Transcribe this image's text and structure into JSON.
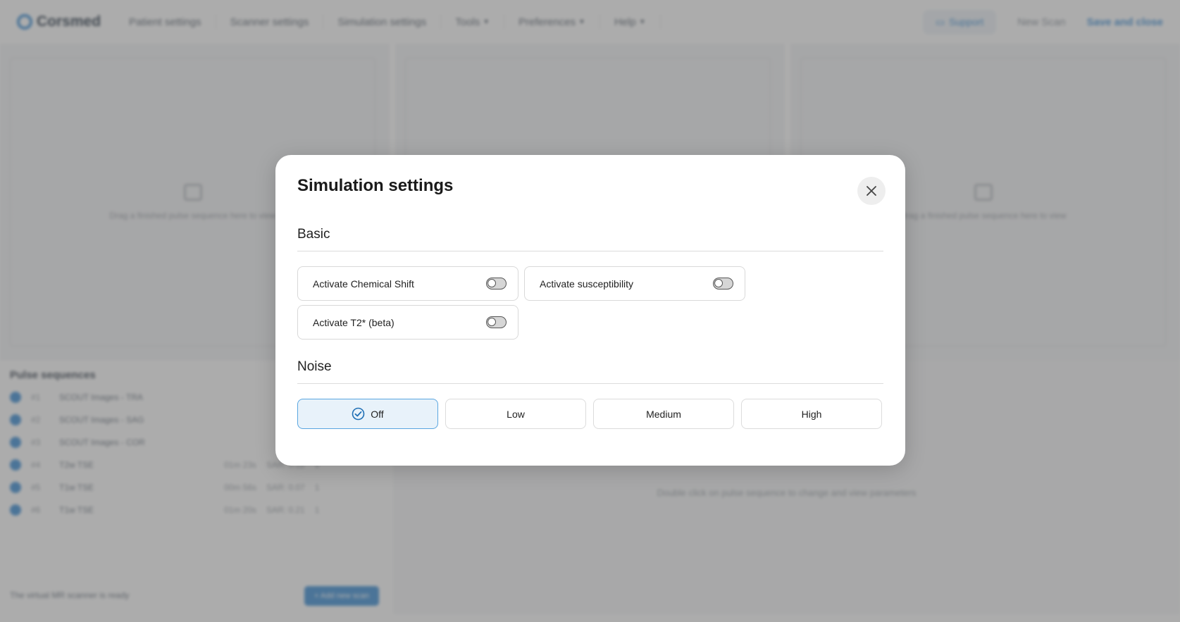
{
  "app": {
    "logo_text": "Corsmed",
    "nav": [
      {
        "label": "Patient settings"
      },
      {
        "label": "Scanner settings"
      },
      {
        "label": "Simulation settings"
      },
      {
        "label": "Tools"
      },
      {
        "label": "Preferences"
      },
      {
        "label": "Help"
      }
    ],
    "support_label": "Support",
    "new_scan_label": "New Scan",
    "save_close_label": "Save and close",
    "panel_hint": "Drag a finished pulse sequence here to view",
    "pulse_title": "Pulse sequences",
    "sequences": [
      {
        "num": "#1",
        "name": "SCOUT Images - TRA",
        "time": "",
        "sar": "",
        "count": ""
      },
      {
        "num": "#2",
        "name": "SCOUT Images - SAG",
        "time": "",
        "sar": "",
        "count": ""
      },
      {
        "num": "#3",
        "name": "SCOUT Images - COR",
        "time": "",
        "sar": "",
        "count": ""
      },
      {
        "num": "#4",
        "name": "T2w TSE",
        "time": "01m 23s",
        "sar": "SAR: 0.12",
        "count": "1"
      },
      {
        "num": "#5",
        "name": "T1w TSE",
        "time": "00m 56s",
        "sar": "SAR: 0.07",
        "count": "1"
      },
      {
        "num": "#6",
        "name": "T1w TSE",
        "time": "01m 20s",
        "sar": "SAR: 0.21",
        "count": "1"
      }
    ],
    "ready_text": "The virtual MR scanner is ready",
    "add_label": "+ Add new scan",
    "param_hint": "Double click on pulse sequence to change and view parameters"
  },
  "modal": {
    "title": "Simulation settings",
    "basic_title": "Basic",
    "toggles": [
      {
        "label": "Activate Chemical Shift",
        "on": false
      },
      {
        "label": "Activate susceptibility",
        "on": false
      },
      {
        "label": "Activate T2* (beta)",
        "on": false
      }
    ],
    "noise_title": "Noise",
    "noise_options": [
      "Off",
      "Low",
      "Medium",
      "High"
    ],
    "noise_selected": "Off"
  },
  "colors": {
    "accent": "#3d8fd6",
    "selected_bg": "#e8f2fa",
    "overlay": "#5a5a5a"
  }
}
